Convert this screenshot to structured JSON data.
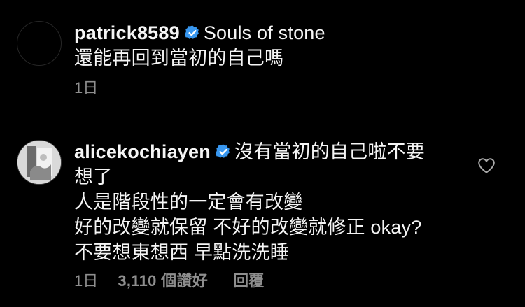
{
  "comments": [
    {
      "username": "patrick8589",
      "verified": true,
      "text_first": "Souls of stone",
      "lines": [
        "還能再回到當初的自己嗎"
      ],
      "time": "1日"
    },
    {
      "username": "alicekochiayen",
      "verified": true,
      "text_first": "沒有當初的自己啦不要",
      "lines": [
        "想了",
        "人是階段性的一定會有改變",
        "好的改變就保留 不好的改變就修正 okay?",
        "不要想東想西 早點洗洗睡"
      ],
      "time": "1日",
      "likes": "3,110 個讚好",
      "reply_label": "回覆"
    }
  ],
  "colors": {
    "background": "#000000",
    "text": "#f5f5f5",
    "meta": "#8e8e8e",
    "verified": "#3897f0"
  },
  "icons": {
    "verified": "verified-badge-icon",
    "like": "heart-outline-icon"
  }
}
